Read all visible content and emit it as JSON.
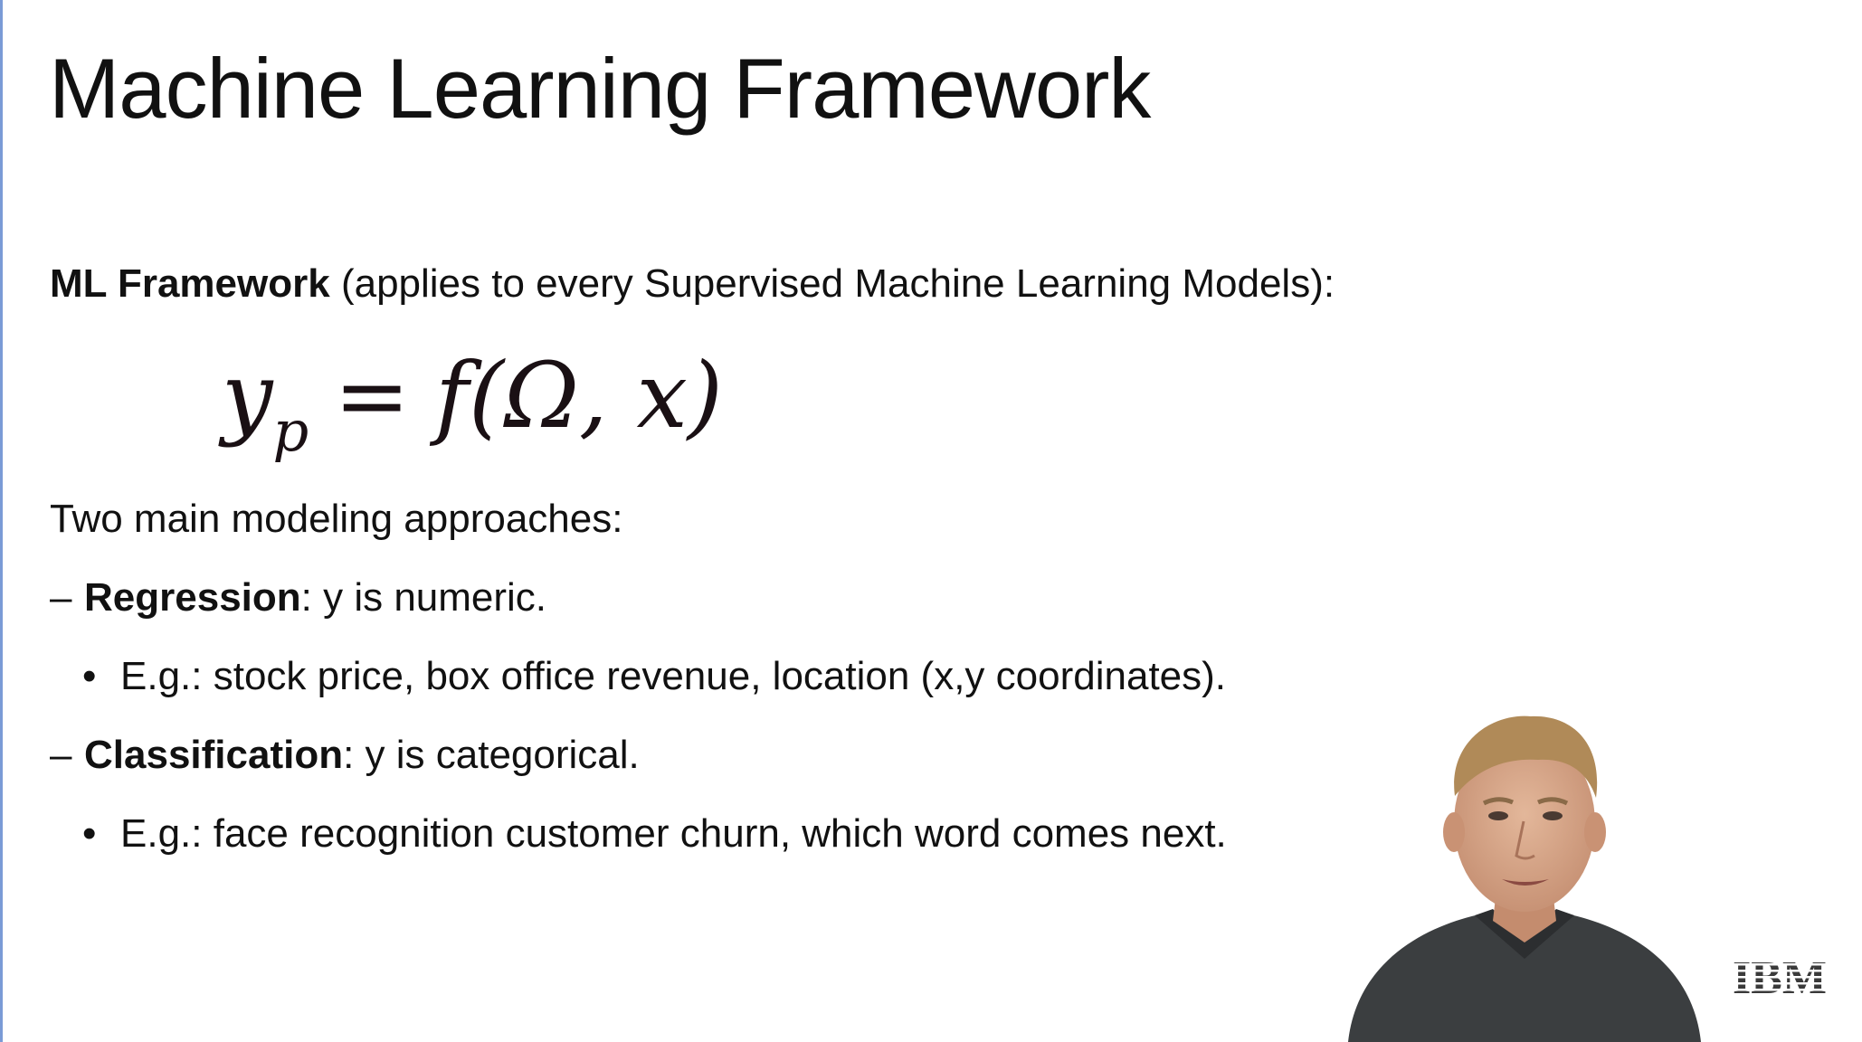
{
  "slide": {
    "title": "Machine Learning Framework",
    "intro_bold": "ML Framework",
    "intro_rest": " (applies to every Supervised Machine Learning Models):",
    "formula": {
      "lhs": "y",
      "lhs_sub": "p",
      "eq": "=",
      "rhs": "f(Ω, x)"
    },
    "approaches_heading": "Two main modeling approaches:",
    "regression": {
      "dash": "–",
      "term": "Regression",
      "desc": ": y is numeric.",
      "bullet": "•",
      "example": "E.g.: stock price, box office revenue, location (x,y coordinates)."
    },
    "classification": {
      "dash": "–",
      "term": "Classification",
      "desc": ": y is categorical.",
      "bullet": "•",
      "example": "E.g.: face recognition customer churn, which word comes next."
    },
    "logo": "IBM"
  },
  "colors": {
    "accent_edge": "#7a9bd6",
    "text": "#111111",
    "ibm_logo": "#3a3a3a"
  }
}
